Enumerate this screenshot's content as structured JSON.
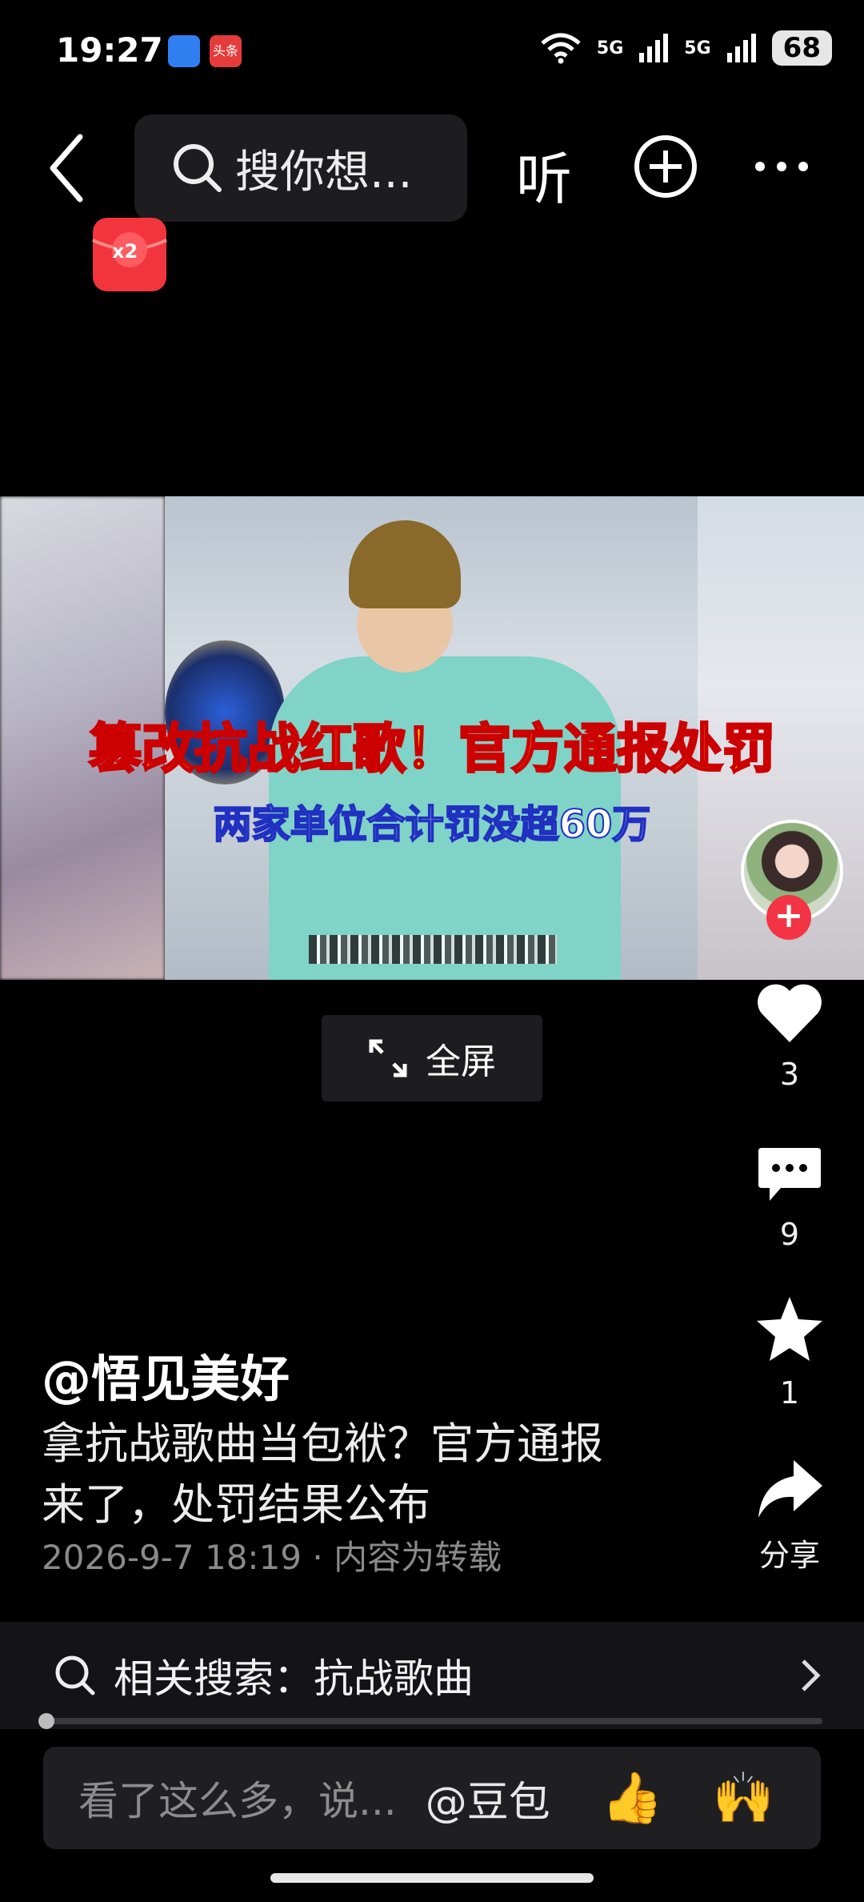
{
  "status_bar": {
    "time": "19:27",
    "app_badge_label": "头条",
    "network1": "5G",
    "network2": "5G",
    "battery": "68"
  },
  "top_bar": {
    "search_placeholder": "搜你想...",
    "listen_label": "听",
    "redpacket_label": "x2"
  },
  "video": {
    "headline": "篡改抗战红歌！官方通报处罚",
    "subheadline": "两家单位合计罚没超60万",
    "fullscreen_label": "全屏"
  },
  "rail": {
    "likes": "3",
    "comments": "9",
    "favorites": "1",
    "share_label": "分享"
  },
  "post": {
    "author": "@悟见美好",
    "description_line1": "拿抗战歌曲当包袱？官方通报",
    "description_line2": "来了，处罚结果公布",
    "meta": "2026-9-7 18:19 · 内容为转载"
  },
  "related_search": {
    "label": "相关搜索：抗战歌曲"
  },
  "comment_bar": {
    "placeholder": "看了这么多，说...",
    "mention": "@豆包",
    "emoji1": "👍",
    "emoji2": "🙌"
  },
  "colors": {
    "background": "#000000",
    "follow_red": "#f33444",
    "surface": "#1d1d1f",
    "muted_text": "#8a8a8a"
  },
  "icons": [
    "back-icon",
    "search-icon",
    "plus-circle-icon",
    "more-icon",
    "heart-icon",
    "comment-icon",
    "star-icon",
    "share-icon",
    "expand-icon",
    "chevron-right-icon"
  ]
}
